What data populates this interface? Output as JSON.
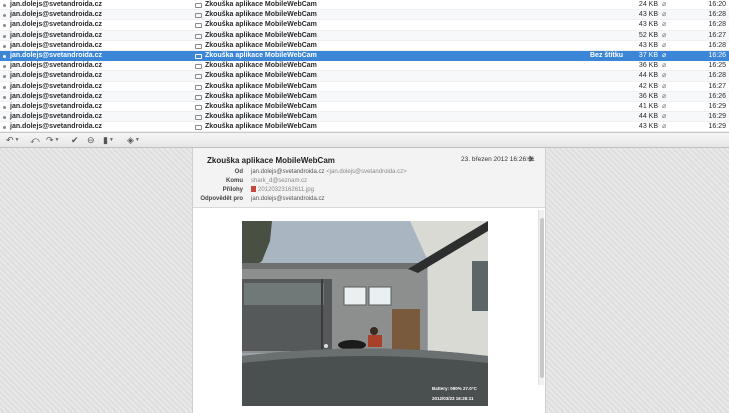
{
  "messages": [
    {
      "from": "jan.dolejs@svetandroida.cz",
      "subject": "Zkouška aplikace MobileWebCam",
      "label": "",
      "size": "24 KB",
      "time": "16:20"
    },
    {
      "from": "jan.dolejs@svetandroida.cz",
      "subject": "Zkouška aplikace MobileWebCam",
      "label": "",
      "size": "43 KB",
      "time": "16:28"
    },
    {
      "from": "jan.dolejs@svetandroida.cz",
      "subject": "Zkouška aplikace MobileWebCam",
      "label": "",
      "size": "43 KB",
      "time": "16:28"
    },
    {
      "from": "jan.dolejs@svetandroida.cz",
      "subject": "Zkouška aplikace MobileWebCam",
      "label": "",
      "size": "52 KB",
      "time": "16:27"
    },
    {
      "from": "jan.dolejs@svetandroida.cz",
      "subject": "Zkouška aplikace MobileWebCam",
      "label": "",
      "size": "43 KB",
      "time": "16:28"
    },
    {
      "from": "jan.dolejs@svetandroida.cz",
      "subject": "Zkouška aplikace MobileWebCam",
      "label": "Bez štítku",
      "size": "37 KB",
      "time": "16:26",
      "selected": true
    },
    {
      "from": "jan.dolejs@svetandroida.cz",
      "subject": "Zkouška aplikace MobileWebCam",
      "label": "",
      "size": "36 KB",
      "time": "16:25"
    },
    {
      "from": "jan.dolejs@svetandroida.cz",
      "subject": "Zkouška aplikace MobileWebCam",
      "label": "",
      "size": "44 KB",
      "time": "16:28"
    },
    {
      "from": "jan.dolejs@svetandroida.cz",
      "subject": "Zkouška aplikace MobileWebCam",
      "label": "",
      "size": "42 KB",
      "time": "16:27"
    },
    {
      "from": "jan.dolejs@svetandroida.cz",
      "subject": "Zkouška aplikace MobileWebCam",
      "label": "",
      "size": "36 KB",
      "time": "16:26"
    },
    {
      "from": "jan.dolejs@svetandroida.cz",
      "subject": "Zkouška aplikace MobileWebCam",
      "label": "",
      "size": "41 KB",
      "time": "16:29"
    },
    {
      "from": "jan.dolejs@svetandroida.cz",
      "subject": "Zkouška aplikace MobileWebCam",
      "label": "",
      "size": "44 KB",
      "time": "16:29"
    },
    {
      "from": "jan.dolejs@svetandroida.cz",
      "subject": "Zkouška aplikace MobileWebCam",
      "label": "",
      "size": "43 KB",
      "time": "16:29"
    }
  ],
  "toolbar": {
    "icons": [
      "reply-icon",
      "reply-all-icon",
      "forward-icon",
      "check-icon",
      "spam-icon",
      "trash-icon",
      "tag-icon"
    ]
  },
  "message": {
    "subject": "Zkouška aplikace MobileWebCam",
    "date": "23. březen 2012 16:26:11",
    "from_label": "Od",
    "from_value": "jan.dolejs@svetandroida.cz",
    "from_addr": "<jan.dolejs@svetandroida.cz>",
    "to_label": "Komu",
    "to_value": "shark_d@seznam.cz",
    "att_label": "Přílohy",
    "att_value": "20120323162611.jpg",
    "reply_label": "Odpovědět pro",
    "reply_value": "jan.dolejs@svetandroida.cz"
  },
  "photo": {
    "stamp_line1": "Battery: 090% 27.0°C",
    "stamp_line2": "2012/03/23   16:26:11"
  },
  "colors": {
    "selected_row": "#3b86d6",
    "accent": "#3b86d6"
  }
}
